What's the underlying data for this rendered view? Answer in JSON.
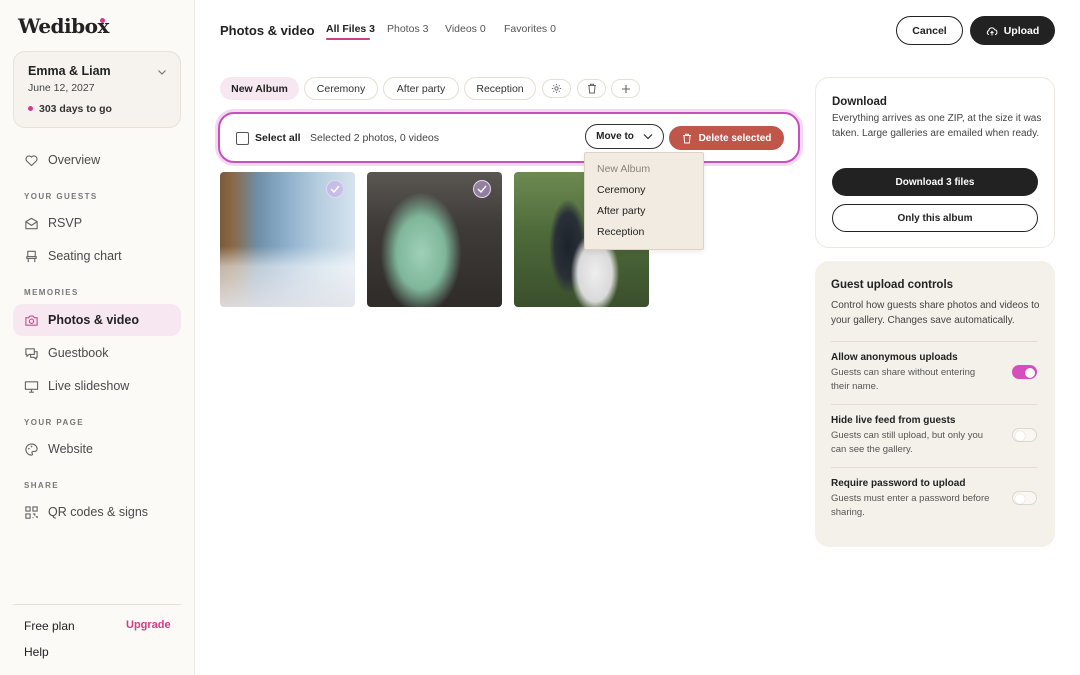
{
  "brand": {
    "logo": "Wedibox",
    "accent": "#d43b8a"
  },
  "event": {
    "name": "Emma & Liam",
    "date": "June 12, 2027",
    "countdown": "303 days to go"
  },
  "sidebar": {
    "overview": "Overview",
    "sections": [
      {
        "label": "YOUR GUESTS",
        "items": [
          "RSVP",
          "Seating chart"
        ]
      },
      {
        "label": "MEMORIES",
        "items": [
          "Photos & video",
          "Guestbook",
          "Live slideshow"
        ]
      },
      {
        "label": "YOUR PAGE",
        "items": [
          "Website"
        ]
      },
      {
        "label": "SHARE",
        "items": [
          "QR codes & signs"
        ]
      }
    ],
    "active_item": "Photos & video",
    "plan": "Free plan",
    "upgrade": "Upgrade",
    "help": "Help"
  },
  "header": {
    "title": "Photos & video",
    "tabs": [
      {
        "label": "All Files 3",
        "active": true
      },
      {
        "label": "Photos 3",
        "active": false
      },
      {
        "label": "Videos 0",
        "active": false
      },
      {
        "label": "Favorites 0",
        "active": false
      }
    ],
    "cancel": "Cancel",
    "upload": "Upload"
  },
  "albums": {
    "chips": [
      "New Album",
      "Ceremony",
      "After party",
      "Reception"
    ],
    "active": "New Album",
    "icon_actions": [
      "settings-icon",
      "trash-icon",
      "plus-icon"
    ]
  },
  "selection": {
    "select_all": "Select all",
    "summary": "Selected 2 photos, 0 videos",
    "move_to": "Move to",
    "delete": "Delete selected",
    "dropdown": [
      "New Album",
      "Ceremony",
      "After party",
      "Reception"
    ]
  },
  "photos": [
    {
      "description_icon": "photo-head-table",
      "selected": true
    },
    {
      "description_icon": "photo-dance-floor",
      "selected": true
    },
    {
      "description_icon": "photo-confetti-exit",
      "selected": false
    }
  ],
  "download": {
    "title": "Download",
    "body": "Everything arrives as one ZIP, at the size it was taken. Large galleries are emailed when ready.",
    "primary": "Download 3 files",
    "secondary": "Only this album"
  },
  "guest_controls": {
    "title": "Guest upload controls",
    "body": "Control how guests share photos and videos to your gallery. Changes save automatically.",
    "settings": [
      {
        "title": "Allow anonymous uploads",
        "desc": "Guests can share without entering their name.",
        "on": true
      },
      {
        "title": "Hide live feed from guests",
        "desc": "Guests can still upload, but only you can see the gallery.",
        "on": false
      },
      {
        "title": "Require password to upload",
        "desc": "Guests must enter a password before sharing.",
        "on": false
      }
    ]
  }
}
